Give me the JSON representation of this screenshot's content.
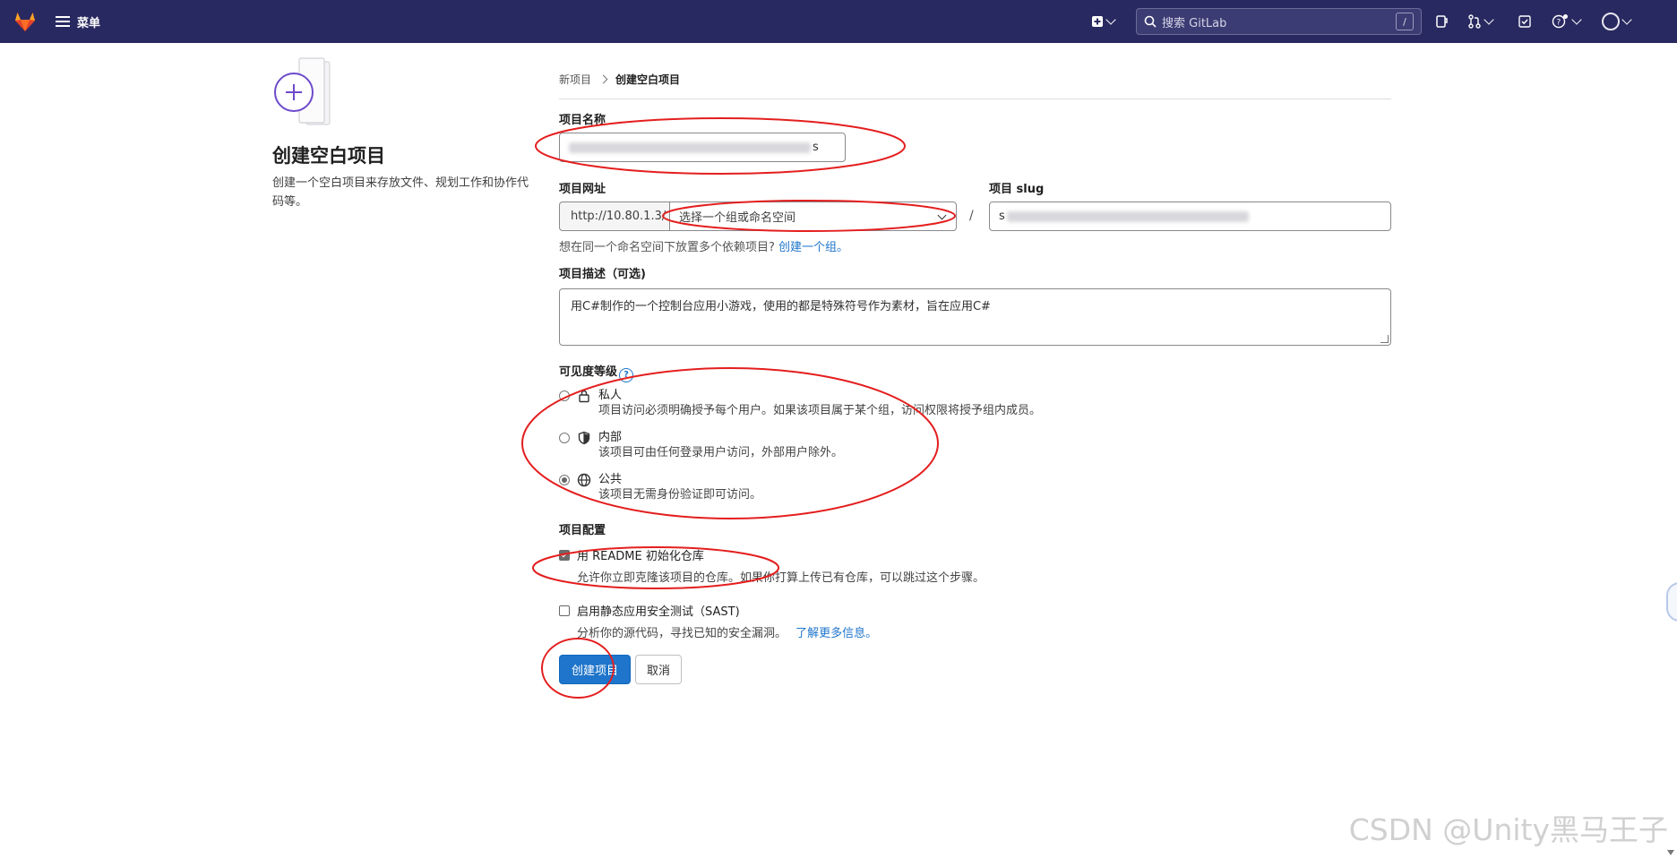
{
  "topbar": {
    "menu_label": "菜单",
    "search_placeholder": "搜索 GitLab",
    "search_shortcut": "/",
    "brand_color": "#292961"
  },
  "intro": {
    "title": "创建空白项目",
    "description": "创建一个空白项目来存放文件、规划工作和协作代码等。"
  },
  "breadcrumb": {
    "parent": "新项目",
    "current": "创建空白项目"
  },
  "form": {
    "project_name_label": "项目名称",
    "project_name_value_tail": "s",
    "project_url_label": "项目网址",
    "url_prefix": "http://10.80.1.3/",
    "namespace_placeholder": "选择一个组或命名空间",
    "url_separator": "/",
    "slug_label": "项目 slug",
    "slug_value_head": "s",
    "namespace_hint": "想在同一个命名空间下放置多个依赖项目?",
    "namespace_hint_link": "创建一个组。",
    "description_label": "项目描述（可选)",
    "description_value": "用C#制作的一个控制台应用小游戏，使用的都是特殊符号作为素材，旨在应用C#",
    "visibility_label": "可见度等级",
    "visibility_help": "?",
    "visibility_options": [
      {
        "title": "私人",
        "desc": "项目访问必须明确授予每个用户。如果该项目属于某个组，访问权限将授予组内成员。",
        "icon": "lock-icon",
        "selected": false
      },
      {
        "title": "内部",
        "desc": "该项目可由任何登录用户访问，外部用户除外。",
        "icon": "shield-icon",
        "selected": false
      },
      {
        "title": "公共",
        "desc": "该项目无需身份验证即可访问。",
        "icon": "globe-icon",
        "selected": true
      }
    ],
    "config_label": "项目配置",
    "readme": {
      "label": "用 README 初始化仓库",
      "desc": "允许你立即克隆该项目的仓库。如果你打算上传已有仓库，可以跳过这个步骤。",
      "checked": true
    },
    "sast": {
      "label": "启用静态应用安全测试（SAST)",
      "desc": "分析你的源代码，寻找已知的安全漏洞。",
      "link": "了解更多信息。",
      "checked": false
    },
    "create_button": "创建项目",
    "cancel_button": "取消"
  },
  "watermark": "CSDN @Unity黑马王子",
  "colors": {
    "primary": "#1f75cb",
    "annotation": "#e41e1e"
  }
}
